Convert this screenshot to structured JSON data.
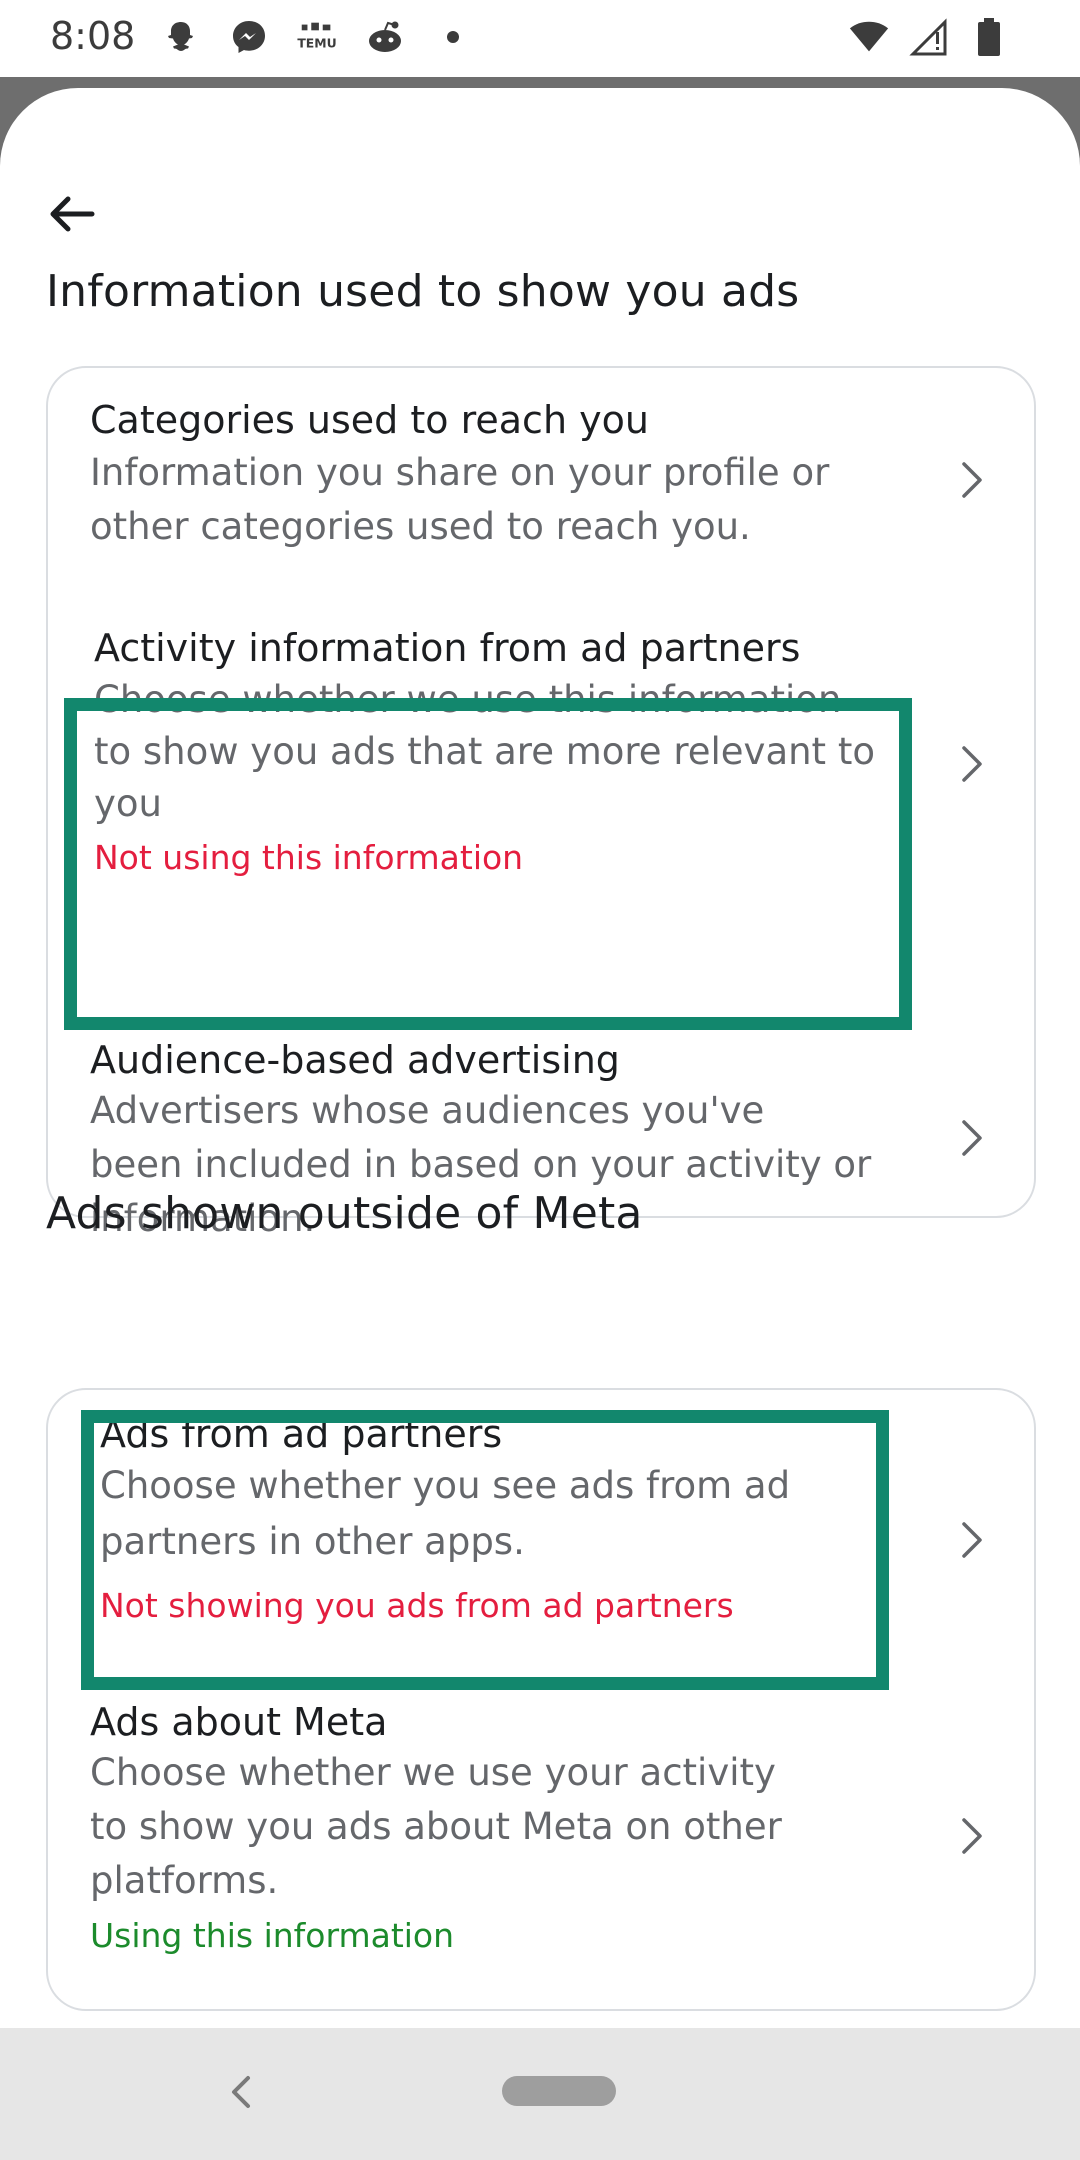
{
  "status_bar": {
    "time": "8:08",
    "left_icons": [
      "snapchat-icon",
      "messenger-icon",
      "temu-icon",
      "reddit-icon",
      "dot-icon"
    ],
    "temu_label": "TEMU",
    "right_icons": [
      "wifi-icon",
      "signal-icon",
      "battery-icon"
    ]
  },
  "header": {
    "back_icon": "arrow-left-icon"
  },
  "section1": {
    "title": "Information used to show you ads",
    "items": [
      {
        "title": "Categories used to reach you",
        "desc_lines": [
          "Information you share on your profile or",
          "other categories used to reach you."
        ]
      },
      {
        "title": "Activity information from ad partners",
        "desc_lines": [
          "Choose whether we use this information",
          "to show you ads that are more relevant to",
          "you"
        ],
        "status": "Not using this information"
      },
      {
        "title": "Audience-based advertising",
        "desc_lines": [
          "Advertisers whose audiences you've",
          "been included in based on your activity or",
          "information."
        ]
      }
    ]
  },
  "section2": {
    "title": "Ads shown outside of Meta",
    "items": [
      {
        "title": "Ads from ad partners",
        "desc_lines": [
          "Choose whether you see ads from ad",
          "partners in other apps."
        ],
        "status": "Not showing you ads from ad partners"
      },
      {
        "title": "Ads about Meta",
        "desc_lines": [
          "Choose whether we use your activity",
          "to show you ads about Meta on other",
          "platforms."
        ],
        "status": "Using this information"
      }
    ]
  },
  "colors": {
    "highlight": "#12876d",
    "status_negative": "#e41e3f",
    "status_positive": "#1c8b2c"
  },
  "nav_bar": {
    "icons": [
      "nav-back-icon",
      "home-pill-icon"
    ]
  }
}
